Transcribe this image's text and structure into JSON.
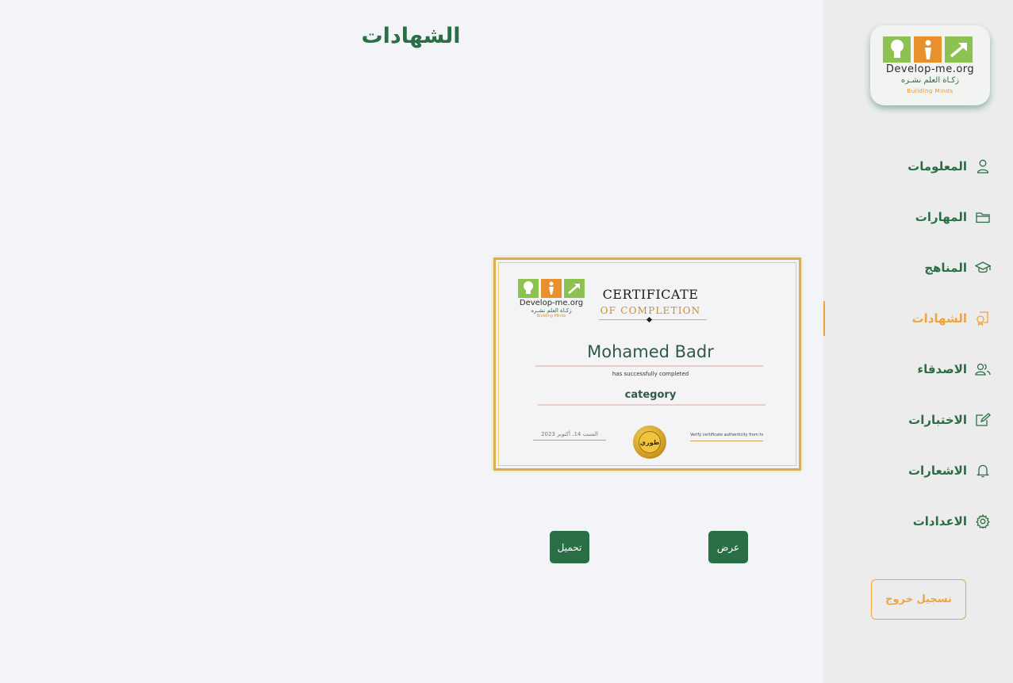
{
  "page": {
    "title": "الشهادات"
  },
  "logo": {
    "title": "Develop-me.org",
    "arabic": "زكـاة العلم نشـره",
    "subtitle": "Building Minds",
    "colors": {
      "green": "#8cc350",
      "orange": "#e8912c"
    }
  },
  "sidebar": {
    "items": [
      {
        "label": "المعلومات",
        "icon": "user-icon",
        "active": false
      },
      {
        "label": "المهارات",
        "icon": "folder-icon",
        "active": false
      },
      {
        "label": "المناهج",
        "icon": "graduation-cap-icon",
        "active": false
      },
      {
        "label": "الشهادات",
        "icon": "certificate-icon",
        "active": true
      },
      {
        "label": "الاصدقاء",
        "icon": "users-icon",
        "active": false
      },
      {
        "label": "الاختبارات",
        "icon": "edit-icon",
        "active": false
      },
      {
        "label": "الاشعارات",
        "icon": "bell-icon",
        "active": false
      },
      {
        "label": "الاعدادات",
        "icon": "gear-icon",
        "active": false
      }
    ],
    "logout_label": "تسجيل خروج"
  },
  "certificate": {
    "heading": "CERTIFICATE",
    "subheading": "OF COMPLETION",
    "name": "Mohamed Badr",
    "completed_text": "has successfully completed",
    "course": "category",
    "date": "السبت 14، أكتوبر 2023",
    "verify_text": "Verify certificate authenticity from here",
    "seal_text": "طوري"
  },
  "actions": {
    "view_label": "عرض",
    "download_label": "تحميل"
  },
  "colors": {
    "primary": "#2a6e45",
    "accent": "#f0a33e",
    "gold": "#d9b04a"
  }
}
